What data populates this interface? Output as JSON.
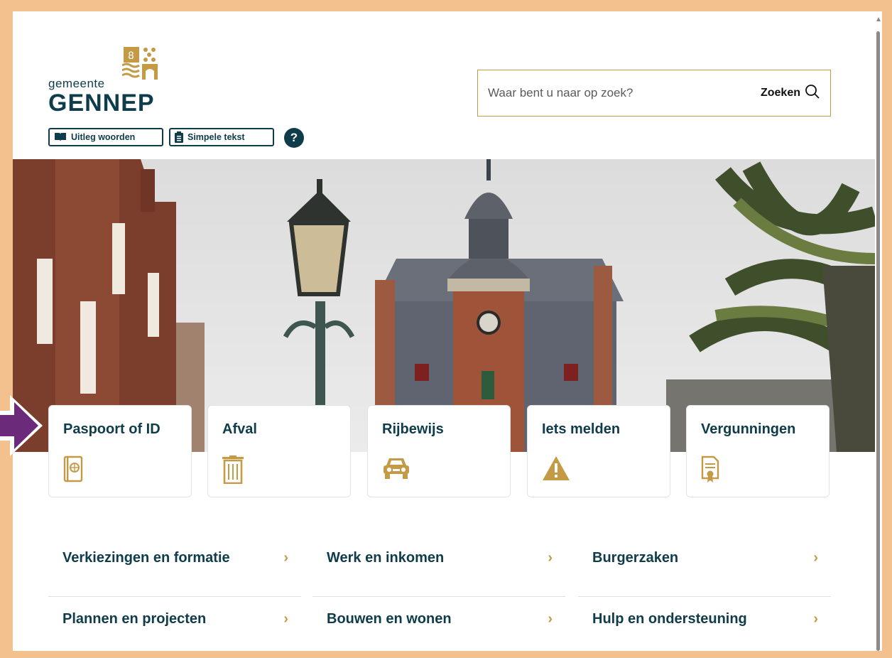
{
  "logo": {
    "small": "gemeente",
    "big": "GENNEP"
  },
  "tools": {
    "words": "Uitleg woorden",
    "simple": "Simpele tekst",
    "help": "?"
  },
  "search": {
    "placeholder": "Waar bent u naar op zoek?",
    "button": "Zoeken"
  },
  "tiles": [
    {
      "label": "Paspoort of ID",
      "icon": "passport-icon"
    },
    {
      "label": "Afval",
      "icon": "trash-bin-icon"
    },
    {
      "label": "Rijbewijs",
      "icon": "car-icon"
    },
    {
      "label": "Iets melden",
      "icon": "warning-icon"
    },
    {
      "label": "Vergunningen",
      "icon": "certificate-icon"
    }
  ],
  "nav": [
    {
      "label": "Verkiezingen en formatie"
    },
    {
      "label": "Werk en inkomen"
    },
    {
      "label": "Burgerzaken"
    },
    {
      "label": "Plannen en projecten"
    },
    {
      "label": "Bouwen en wonen"
    },
    {
      "label": "Hulp en ondersteuning"
    }
  ],
  "chevron": "›",
  "colors": {
    "brand": "#0f3c4a",
    "accent": "#c49a45",
    "pointer": "#6b2a7a",
    "frame": "#f2c18e"
  }
}
